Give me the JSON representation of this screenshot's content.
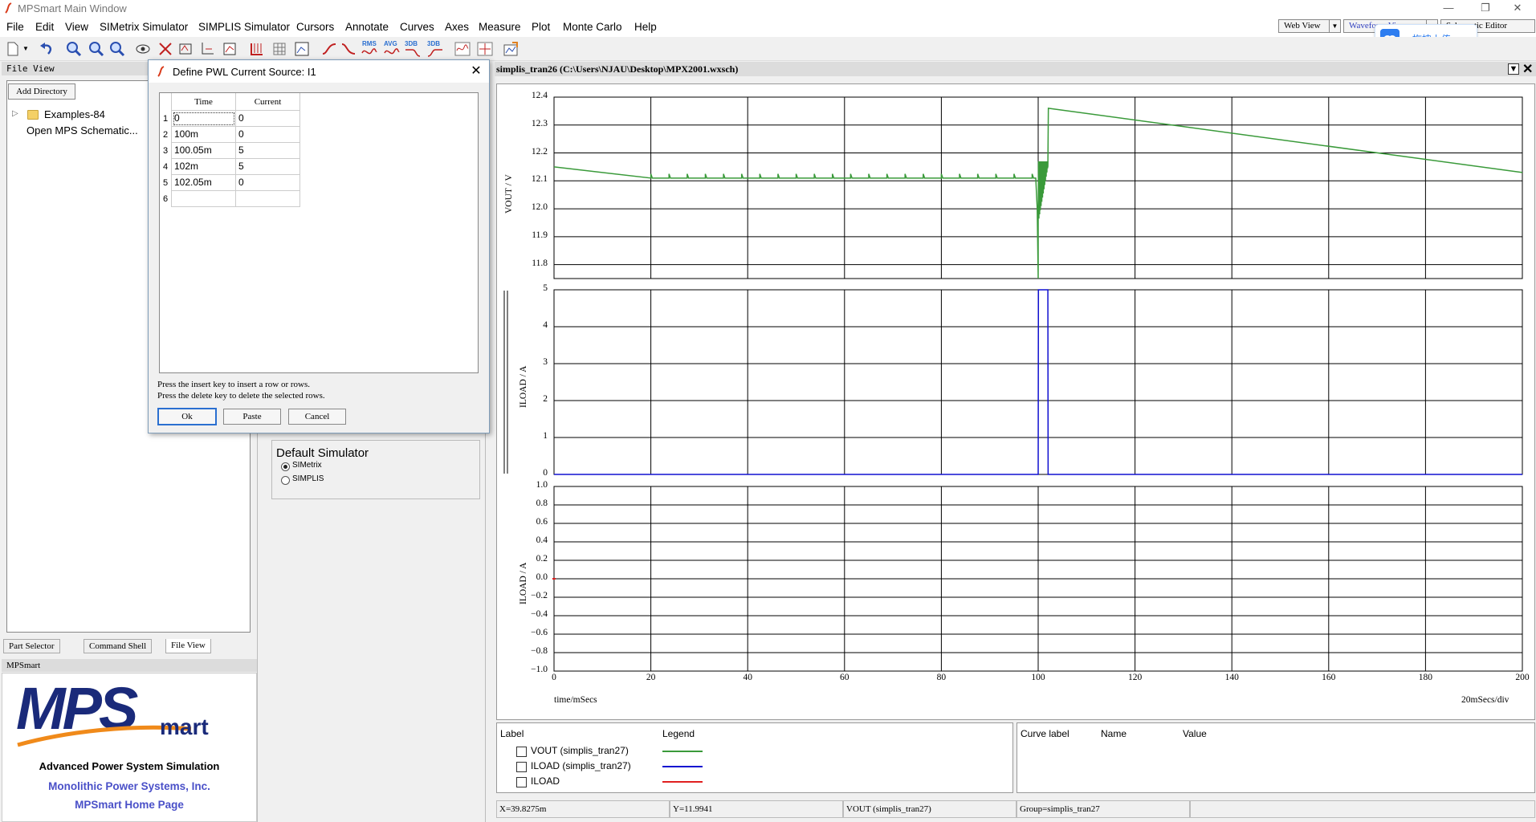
{
  "window": {
    "title": "MPSmart Main Window"
  },
  "menu": [
    "File",
    "Edit",
    "View",
    "SIMetrix Simulator",
    "SIMPLIS Simulator",
    "Cursors",
    "Annotate",
    "Curves",
    "Axes",
    "Measure",
    "Plot",
    "Monte Carlo",
    "Help"
  ],
  "view_tabs": {
    "web_view": "Web View",
    "waveform_viewer": "Waveform Viewer",
    "schematic_editor": "Schematic Editor"
  },
  "upload": {
    "label": "拖拽上传"
  },
  "toolbar": {
    "rms": "RMS",
    "avg": "AVG",
    "db1": "3DB",
    "db2": "3DB"
  },
  "file_view": {
    "header": "File View",
    "add_directory": "Add Directory",
    "items": [
      "Examples-84",
      "Open MPS Schematic..."
    ]
  },
  "bottom_tabs": [
    "Part Selector",
    "Command Shell",
    "File View"
  ],
  "mps_panel": {
    "header": "MPSmart",
    "logo_main": "MPS",
    "logo_sub": "mart",
    "tagline": "Advanced Power System Simulation",
    "company": "Monolithic Power Systems, Inc.",
    "home": "MPSmart Home Page"
  },
  "simulator": {
    "title": "Default Simulator",
    "options": [
      "SIMetrix",
      "SIMPLIS"
    ],
    "selected": "SIMetrix"
  },
  "dialog": {
    "title": "Define PWL Current Source: I1",
    "columns": [
      "Time",
      "Current"
    ],
    "rows": [
      {
        "n": "1",
        "time": "0",
        "current": "0"
      },
      {
        "n": "2",
        "time": "100m",
        "current": "0"
      },
      {
        "n": "3",
        "time": "100.05m",
        "current": "5"
      },
      {
        "n": "4",
        "time": "102m",
        "current": "5"
      },
      {
        "n": "5",
        "time": "102.05m",
        "current": "0"
      },
      {
        "n": "6",
        "time": "",
        "current": ""
      }
    ],
    "help1": "Press the insert key to insert a row or rows.",
    "help2": "Press the delete key to delete the selected rows.",
    "ok": "Ok",
    "paste": "Paste",
    "cancel": "Cancel"
  },
  "waveform": {
    "tab_title": "simplis_tran26  (C:\\Users\\NJAU\\Desktop\\MPX2001.wxsch)",
    "x_label": "time/mSecs",
    "x_div": "20mSecs/div",
    "x_ticks": [
      "0",
      "20",
      "40",
      "60",
      "80",
      "100",
      "120",
      "140",
      "160",
      "180",
      "200"
    ],
    "plots": [
      {
        "ylabel": "VOUT / V",
        "ticks": [
          "12.4",
          "12.3",
          "12.2",
          "12.1",
          "12.0",
          "11.9",
          "11.8"
        ]
      },
      {
        "ylabel": "ILOAD / A",
        "ticks": [
          "5",
          "4",
          "3",
          "2",
          "1",
          "0"
        ]
      },
      {
        "ylabel": "ILOAD / A",
        "ticks": [
          "1.0",
          "0.8",
          "0.6",
          "0.4",
          "0.2",
          "0.0",
          "−0.2",
          "−0.4",
          "−0.6",
          "−0.8",
          "−1.0"
        ]
      }
    ]
  },
  "chart_data": [
    {
      "type": "line",
      "ylabel": "VOUT / V",
      "xlabel": "time/mSecs",
      "xlim": [
        0,
        200
      ],
      "ylim": [
        11.75,
        12.4
      ],
      "grid": true,
      "series": [
        {
          "name": "VOUT (simplis_tran27)",
          "color": "#3a9a3a",
          "x": [
            0,
            20,
            99.5,
            100,
            100.2,
            100.5,
            101,
            102,
            102.1,
            200
          ],
          "y": [
            12.15,
            12.11,
            12.11,
            11.75,
            12.0,
            12.1,
            12.12,
            12.15,
            12.36,
            12.13
          ]
        }
      ]
    },
    {
      "type": "line",
      "ylabel": "ILOAD / A",
      "xlabel": "time/mSecs",
      "xlim": [
        0,
        200
      ],
      "ylim": [
        0,
        5
      ],
      "grid": true,
      "series": [
        {
          "name": "ILOAD (simplis_tran27)",
          "color": "#1010d0",
          "x": [
            0,
            100,
            100.05,
            102,
            102.05,
            200
          ],
          "y": [
            0,
            0,
            5,
            5,
            0,
            0
          ]
        }
      ]
    },
    {
      "type": "line",
      "ylabel": "ILOAD / A",
      "xlabel": "time/mSecs",
      "xlim": [
        0,
        200
      ],
      "ylim": [
        -1.0,
        1.0
      ],
      "grid": true,
      "series": [
        {
          "name": "ILOAD",
          "color": "#e02020",
          "x": [],
          "y": []
        }
      ]
    }
  ],
  "legend": {
    "label_hdr": "Label",
    "legend_hdr": "Legend",
    "items": [
      {
        "label": "VOUT (simplis_tran27)",
        "color": "#3a9a3a"
      },
      {
        "label": "ILOAD (simplis_tran27)",
        "color": "#1010d0"
      },
      {
        "label": "ILOAD",
        "color": "#e02020"
      }
    ]
  },
  "cursor_table": {
    "curve_label": "Curve label",
    "name": "Name",
    "value": "Value"
  },
  "status": {
    "x": "X=39.8275m",
    "y": "Y=11.9941",
    "curve": "VOUT (simplis_tran27)",
    "group": "Group=simplis_tran27"
  }
}
